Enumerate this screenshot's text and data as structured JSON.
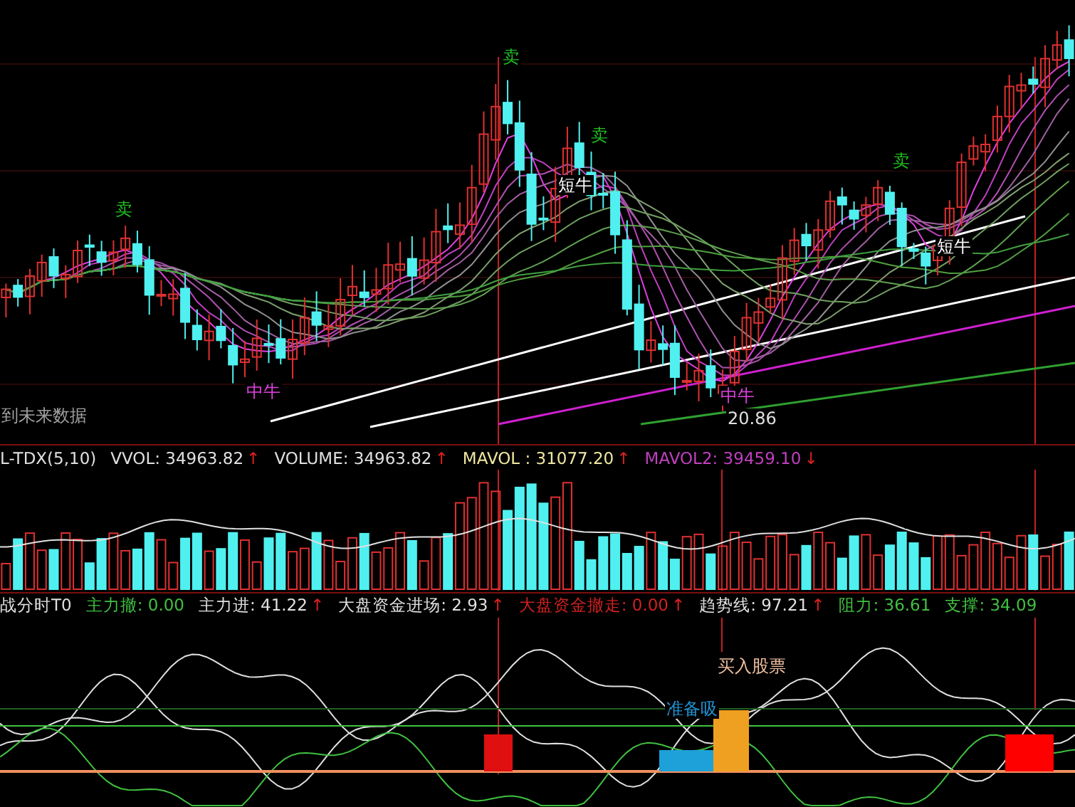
{
  "price_panel": {
    "signals": [
      {
        "kind": "sell",
        "text": "卖"
      },
      {
        "kind": "sell",
        "text": "卖"
      },
      {
        "kind": "sell",
        "text": "卖"
      },
      {
        "kind": "sell",
        "text": "卖"
      },
      {
        "kind": "short_bull",
        "text": "短牛"
      },
      {
        "kind": "short_bull",
        "text": "短牛"
      },
      {
        "kind": "mid_bull",
        "text": "中牛"
      },
      {
        "kind": "mid_bull",
        "text": "中牛"
      },
      {
        "kind": "low_price",
        "text": "20.86"
      },
      {
        "kind": "note",
        "text": "到未来数据"
      }
    ]
  },
  "volume_panel": {
    "header": [
      {
        "text": "L-TDX(5,10)",
        "color": "#e0e0e0"
      },
      {
        "text": "VVOL: 34963.82",
        "color": "#e0e0e0",
        "arrow": "↑"
      },
      {
        "text": "VOLUME: 34963.82",
        "color": "#e0e0e0",
        "arrow": "↑"
      },
      {
        "text": "MAVOL : 31077.20",
        "color": "#f0e8a0",
        "arrow": "↑"
      },
      {
        "text": "MAVOL2: 39459.10",
        "color": "#c040c0",
        "arrow": "↓"
      }
    ]
  },
  "indicator_panel": {
    "header": [
      {
        "text": "战分时T0",
        "color": "#e0e0e0"
      },
      {
        "text": "主力撤: 0.00",
        "color": "#40c040"
      },
      {
        "text": "主力进: 41.22",
        "color": "#e0e0e0",
        "arrow": "↑"
      },
      {
        "text": "大盘资金进场: 2.93",
        "color": "#e0e0e0",
        "arrow": "↑"
      },
      {
        "text": "大盘资金撤走: 0.00",
        "color": "#d02020",
        "arrow": "↑"
      },
      {
        "text": "趋势线: 97.21",
        "color": "#e0e0e0",
        "arrow": "↑"
      },
      {
        "text": "阻力: 36.61",
        "color": "#40c040"
      },
      {
        "text": "支撑: 34.09",
        "color": "#40c040"
      }
    ],
    "labels": [
      {
        "kind": "buy",
        "text": "买入股票"
      },
      {
        "kind": "prepare",
        "text": "准备吸"
      }
    ]
  }
}
